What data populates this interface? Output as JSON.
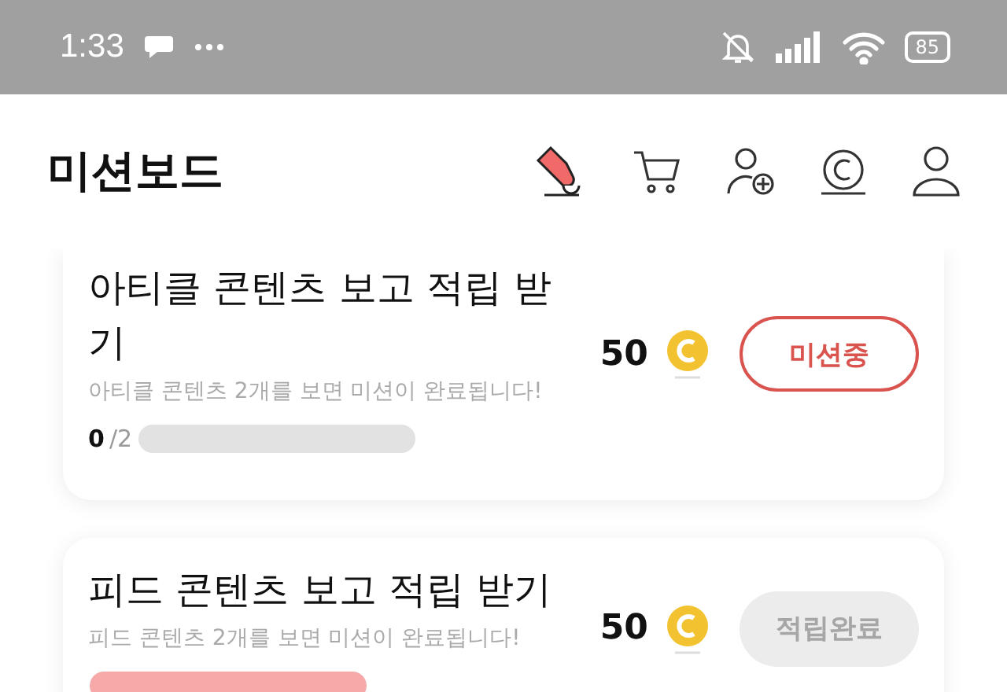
{
  "status_bar": {
    "time": "1:33",
    "battery": "85"
  },
  "header": {
    "title": "미션보드"
  },
  "missions": [
    {
      "title": "아티클 콘텐츠 보고 적립 받기",
      "description": "아티클 콘텐츠 2개를 보면 미션이 완료됩니다!",
      "progress_done": "0",
      "progress_total": "/2",
      "level": 0,
      "reward": "50",
      "button": {
        "label": "미션중",
        "kind": "in_progress"
      }
    },
    {
      "title": "피드 콘텐츠 보고 적립 받기",
      "description": "피드 콘텐츠 2개를 보면 미션이 완료됩니다!",
      "level": 1,
      "reward": "50",
      "button": {
        "label": "적립완료",
        "kind": "completed"
      }
    }
  ]
}
